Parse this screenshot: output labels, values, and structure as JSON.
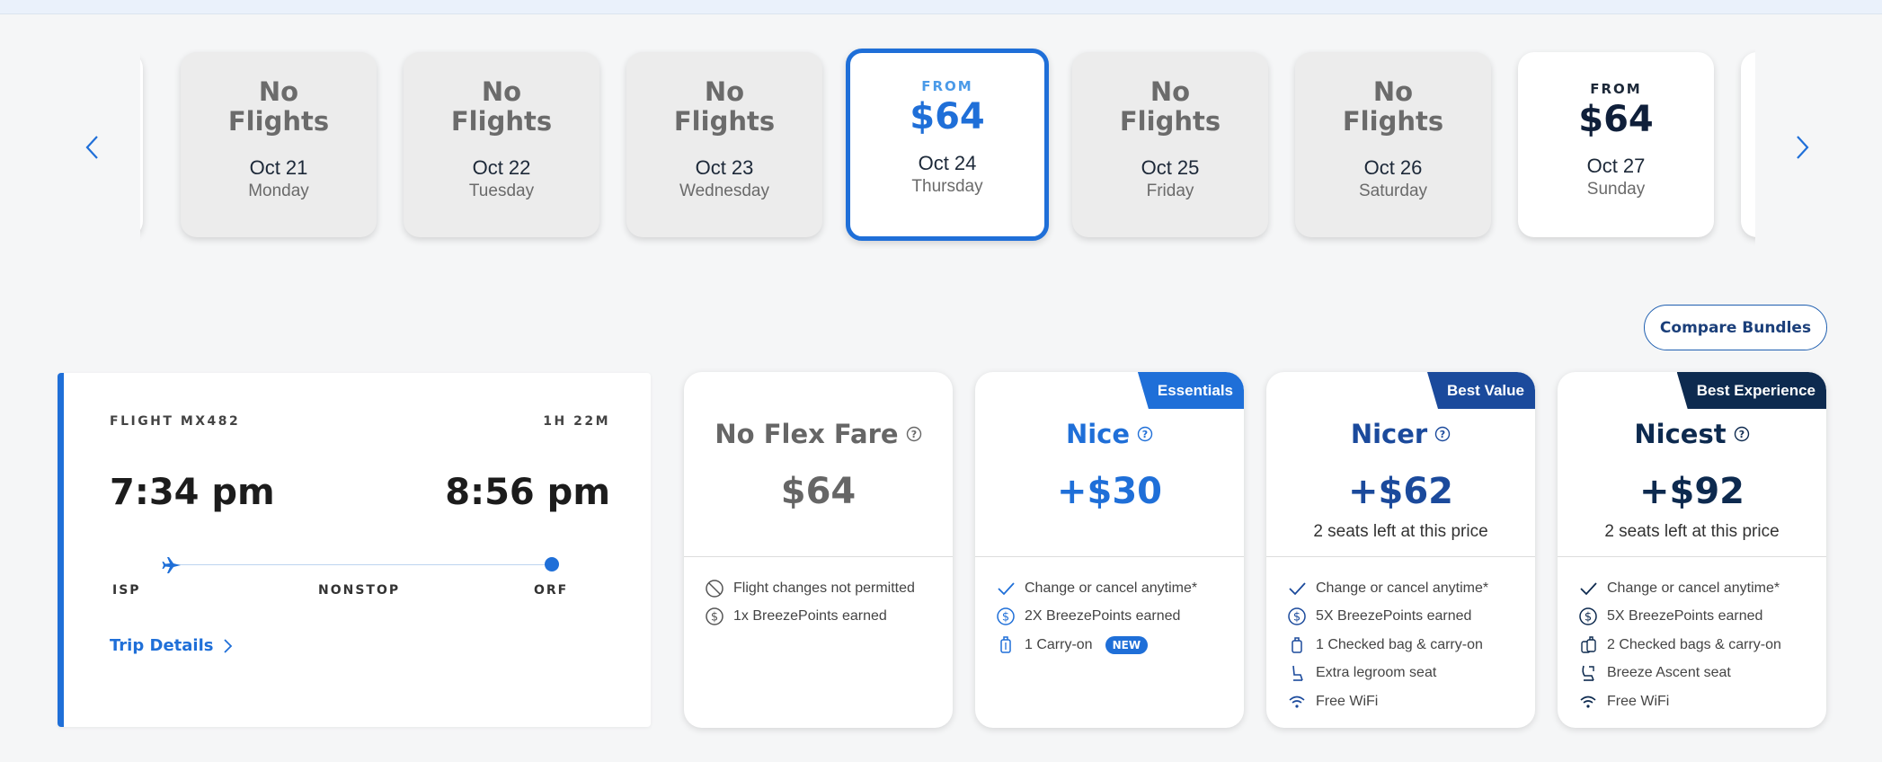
{
  "colors": {
    "accent": "#1f6fd8",
    "navy": "#0f1f3a",
    "nicer_blue": "#1b4a9c",
    "nicest_navy": "#0d2a4f",
    "muted_card": "#ececec"
  },
  "carousel": {
    "prev_icon": "chevron-left-icon",
    "next_icon": "chevron-right-icon",
    "days": [
      {
        "status": "No\nFlights",
        "date": "Oct 21",
        "weekday": "Monday"
      },
      {
        "status": "No\nFlights",
        "date": "Oct 22",
        "weekday": "Tuesday"
      },
      {
        "status": "No\nFlights",
        "date": "Oct 23",
        "weekday": "Wednesday"
      },
      {
        "from": "FROM",
        "price": "$64",
        "date": "Oct 24",
        "weekday": "Thursday",
        "selected": true
      },
      {
        "status": "No\nFlights",
        "date": "Oct 25",
        "weekday": "Friday"
      },
      {
        "status": "No\nFlights",
        "date": "Oct 26",
        "weekday": "Saturday"
      },
      {
        "from": "FROM",
        "price": "$64",
        "date": "Oct 27",
        "weekday": "Sunday"
      }
    ]
  },
  "compare_bundles": "Compare Bundles",
  "flight": {
    "number": "FLIGHT MX482",
    "duration": "1H 22M",
    "depart_time": "7:34 pm",
    "arrive_time": "8:56 pm",
    "origin": "ISP",
    "stops": "NONSTOP",
    "destination": "ORF",
    "trip_details": "Trip Details"
  },
  "fares": [
    {
      "name": "No Flex Fare",
      "price": "$64",
      "badge": "",
      "note": "",
      "features": [
        {
          "icon": "no-entry-icon",
          "text": "Flight changes not permitted"
        },
        {
          "icon": "dollar-icon",
          "text": "1x BreezePoints earned"
        }
      ]
    },
    {
      "name": "Nice",
      "price": "+$30",
      "badge": "Essentials",
      "note": "",
      "features": [
        {
          "icon": "check-icon",
          "text": "Change or cancel anytime*"
        },
        {
          "icon": "dollar-icon",
          "text": "2X BreezePoints earned"
        },
        {
          "icon": "carry-on-icon",
          "text": "1 Carry-on",
          "pill": "NEW"
        }
      ]
    },
    {
      "name": "Nicer",
      "price": "+$62",
      "badge": "Best Value",
      "note": "2 seats left at this price",
      "features": [
        {
          "icon": "check-icon",
          "text": "Change or cancel anytime*"
        },
        {
          "icon": "dollar-icon",
          "text": "5X BreezePoints earned"
        },
        {
          "icon": "bag-icon",
          "text": "1 Checked bag & carry-on"
        },
        {
          "icon": "seat-icon",
          "text": "Extra legroom seat"
        },
        {
          "icon": "wifi-icon",
          "text": "Free WiFi"
        }
      ]
    },
    {
      "name": "Nicest",
      "price": "+$92",
      "badge": "Best Experience",
      "note": "2 seats left at this price",
      "features": [
        {
          "icon": "check-icon",
          "text": "Change or cancel anytime*"
        },
        {
          "icon": "dollar-icon",
          "text": "5X BreezePoints earned"
        },
        {
          "icon": "bags-icon",
          "text": "2 Checked bags & carry-on"
        },
        {
          "icon": "premium-seat-icon",
          "text": "Breeze Ascent seat"
        },
        {
          "icon": "wifi-icon",
          "text": "Free WiFi"
        }
      ]
    }
  ]
}
